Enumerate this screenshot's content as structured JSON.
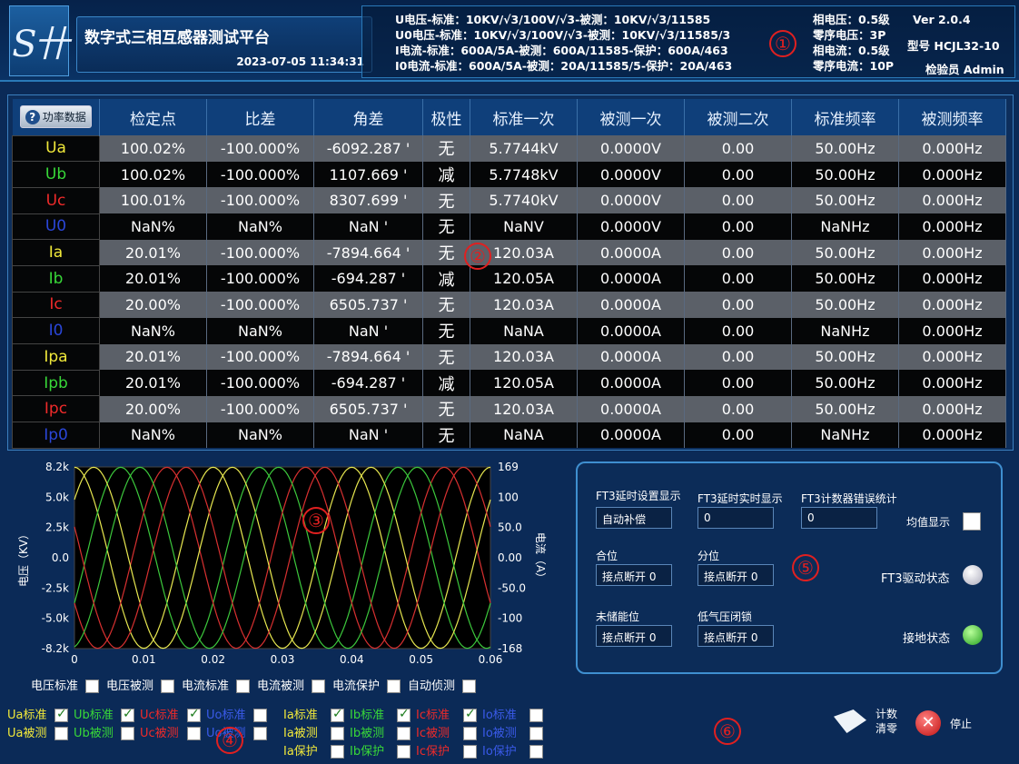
{
  "header": {
    "logo_text": "S卄",
    "app_title": "数字式三相互感器测试平台",
    "datetime": "2023-07-05  11:34:31",
    "info_lines": [
      "U电压-标准：10KV/√3/100V/√3-被测：10KV/√3/11585",
      "U0电压-标准：10KV/√3/100V/√3-被测：10KV/√3/11585/3",
      "I电流-标准：600A/5A-被测：600A/11585-保护：600A/463",
      "I0电流-标准：600A/5A-被测：20A/11585/5-保护：20A/463"
    ],
    "accuracy": [
      "相电压：0.5级",
      "零序电压：3P",
      "相电流：0.5级",
      "零序电流：10P"
    ],
    "version": "Ver 2.0.4",
    "model": "型号 HCJL32-10",
    "operator": "检验员 Admin"
  },
  "markers": [
    "①",
    "②",
    "③",
    "④",
    "⑤",
    "⑥"
  ],
  "table": {
    "power_button": "功率数据",
    "headers": [
      "检定点",
      "比差",
      "角差",
      "极性",
      "标准一次",
      "被测一次",
      "被测二次",
      "标准频率",
      "被测频率"
    ],
    "rows": [
      {
        "ch": "Ua",
        "color": "#f0e83a",
        "vals": [
          "100.02%",
          "-100.000%",
          "-6092.287 '",
          "无",
          "5.7744kV",
          "0.0000V",
          "0.00",
          "50.00Hz",
          "0.000Hz"
        ]
      },
      {
        "ch": "Ub",
        "color": "#38d838",
        "vals": [
          "100.02%",
          "-100.000%",
          "1107.669 '",
          "减",
          "5.7748kV",
          "0.0000V",
          "0.00",
          "50.00Hz",
          "0.000Hz"
        ]
      },
      {
        "ch": "Uc",
        "color": "#ee2a2a",
        "vals": [
          "100.01%",
          "-100.000%",
          "8307.699 '",
          "无",
          "5.7740kV",
          "0.0000V",
          "0.00",
          "50.00Hz",
          "0.000Hz"
        ]
      },
      {
        "ch": "U0",
        "color": "#2a46d8",
        "vals": [
          "NaN%",
          "NaN%",
          "NaN '",
          "无",
          "NaNV",
          "0.0000V",
          "0.00",
          "NaNHz",
          "0.000Hz"
        ]
      },
      {
        "ch": "Ia",
        "color": "#f0e83a",
        "vals": [
          "20.01%",
          "-100.000%",
          "-7894.664 '",
          "无",
          "120.03A",
          "0.0000A",
          "0.00",
          "50.00Hz",
          "0.000Hz"
        ]
      },
      {
        "ch": "Ib",
        "color": "#38d838",
        "vals": [
          "20.01%",
          "-100.000%",
          "-694.287 '",
          "减",
          "120.05A",
          "0.0000A",
          "0.00",
          "50.00Hz",
          "0.000Hz"
        ]
      },
      {
        "ch": "Ic",
        "color": "#ee2a2a",
        "vals": [
          "20.00%",
          "-100.000%",
          "6505.737 '",
          "无",
          "120.03A",
          "0.0000A",
          "0.00",
          "50.00Hz",
          "0.000Hz"
        ]
      },
      {
        "ch": "I0",
        "color": "#2a46d8",
        "vals": [
          "NaN%",
          "NaN%",
          "NaN '",
          "无",
          "NaNA",
          "0.0000A",
          "0.00",
          "NaNHz",
          "0.000Hz"
        ]
      },
      {
        "ch": "Ipa",
        "color": "#f0e83a",
        "vals": [
          "20.01%",
          "-100.000%",
          "-7894.664 '",
          "无",
          "120.03A",
          "0.0000A",
          "0.00",
          "50.00Hz",
          "0.000Hz"
        ]
      },
      {
        "ch": "Ipb",
        "color": "#38d838",
        "vals": [
          "20.01%",
          "-100.000%",
          "-694.287 '",
          "减",
          "120.05A",
          "0.0000A",
          "0.00",
          "50.00Hz",
          "0.000Hz"
        ]
      },
      {
        "ch": "Ipc",
        "color": "#ee2a2a",
        "vals": [
          "20.00%",
          "-100.000%",
          "6505.737 '",
          "无",
          "120.03A",
          "0.0000A",
          "0.00",
          "50.00Hz",
          "0.000Hz"
        ]
      },
      {
        "ch": "Ip0",
        "color": "#2a46d8",
        "vals": [
          "NaN%",
          "NaN%",
          "NaN '",
          "无",
          "NaNA",
          "0.0000A",
          "0.00",
          "NaNHz",
          "0.000Hz"
        ]
      }
    ]
  },
  "chart_data": {
    "type": "line",
    "xlim": [
      0,
      0.06
    ],
    "x_ticks": [
      "0",
      "0.01",
      "0.02",
      "0.03",
      "0.04",
      "0.05",
      "0.06"
    ],
    "left_ticks": [
      "8.2k",
      "5.0k",
      "2.5k",
      "0.0",
      "-2.5k",
      "-5.0k",
      "-8.2k"
    ],
    "right_ticks": [
      "169",
      "100",
      "50.0",
      "0.00",
      "-50.0",
      "-100",
      "-168"
    ],
    "ylabel_left": "电压（KV）",
    "ylabel_right": "电流（A）",
    "ylim_left": [
      -8200,
      8200
    ],
    "ylim_right": [
      -168,
      169
    ],
    "grid": false,
    "series": [
      {
        "color": "#e8e850",
        "amplitude": 8166,
        "frequency": 50,
        "phase_deg": 90
      },
      {
        "color": "#3cc83c",
        "amplitude": 8166,
        "frequency": 50,
        "phase_deg": -30
      },
      {
        "color": "#d83030",
        "amplitude": 8166,
        "frequency": 50,
        "phase_deg": 210
      },
      {
        "color": "#e8e850",
        "amplitude": 8166,
        "frequency": 50,
        "phase_deg": 40
      },
      {
        "color": "#3cc83c",
        "amplitude": 8166,
        "frequency": 50,
        "phase_deg": -80
      },
      {
        "color": "#d83030",
        "amplitude": 8166,
        "frequency": 50,
        "phase_deg": 160
      }
    ]
  },
  "chart_toggles": {
    "row1": [
      {
        "label": "电压标准",
        "checked": false
      },
      {
        "label": "电压被测",
        "checked": false
      },
      {
        "label": "电流标准",
        "checked": false
      },
      {
        "label": "电流被测",
        "checked": false
      },
      {
        "label": "电流保护",
        "checked": false
      },
      {
        "label": "自动侦测",
        "checked": false
      }
    ],
    "u_std": [
      {
        "label": "Ua标准",
        "color": "#f0e83a",
        "checked": true
      },
      {
        "label": "Ub标准",
        "color": "#38d838",
        "checked": true
      },
      {
        "label": "Uc标准",
        "color": "#ee2a2a",
        "checked": true
      },
      {
        "label": "Uo标准",
        "color": "#3a5ae8",
        "checked": false
      }
    ],
    "u_test": [
      {
        "label": "Ua被测",
        "color": "#f0e83a",
        "checked": false
      },
      {
        "label": "Ub被测",
        "color": "#38d838",
        "checked": false
      },
      {
        "label": "Uc被测",
        "color": "#ee2a2a",
        "checked": false
      },
      {
        "label": "Uo被测",
        "color": "#3a5ae8",
        "checked": false
      }
    ],
    "i_std": [
      {
        "label": "Ia标准",
        "color": "#f0e83a",
        "checked": true
      },
      {
        "label": "Ib标准",
        "color": "#38d838",
        "checked": true
      },
      {
        "label": "Ic标准",
        "color": "#ee2a2a",
        "checked": true
      },
      {
        "label": "Io标准",
        "color": "#3a5ae8",
        "checked": false
      }
    ],
    "i_test": [
      {
        "label": "Ia被测",
        "color": "#f0e83a",
        "checked": false
      },
      {
        "label": "Ib被测",
        "color": "#38d838",
        "checked": false
      },
      {
        "label": "Ic被测",
        "color": "#ee2a2a",
        "checked": false
      },
      {
        "label": "Io被测",
        "color": "#3a5ae8",
        "checked": false
      }
    ],
    "i_prot": [
      {
        "label": "Ia保护",
        "color": "#f0e83a",
        "checked": false
      },
      {
        "label": "Ib保护",
        "color": "#38d838",
        "checked": false
      },
      {
        "label": "Ic保护",
        "color": "#ee2a2a",
        "checked": false
      },
      {
        "label": "Io保护",
        "color": "#3a5ae8",
        "checked": false
      }
    ]
  },
  "ft3": {
    "delay_setting_label": "FT3延时设置显示",
    "delay_setting_value": "自动补偿",
    "delay_realtime_label": "FT3延时实时显示",
    "delay_realtime_value": "0",
    "counter_error_label": "FT3计数器错误统计",
    "counter_error_value": "0",
    "avg_display_label": "均值显示",
    "close_label": "合位",
    "close_value": "接点断开 0",
    "open_label": "分位",
    "open_value": "接点断开 0",
    "uncharged_label": "未储能位",
    "uncharged_value": "接点断开 0",
    "low_pressure_label": "低气压闭锁",
    "low_pressure_value": "接点断开 0",
    "drive_status_label": "FT3驱动状态",
    "ground_status_label": "接地状态"
  },
  "buttons": {
    "clear_line1": "计数",
    "clear_line2": "清零",
    "stop": "停止"
  }
}
